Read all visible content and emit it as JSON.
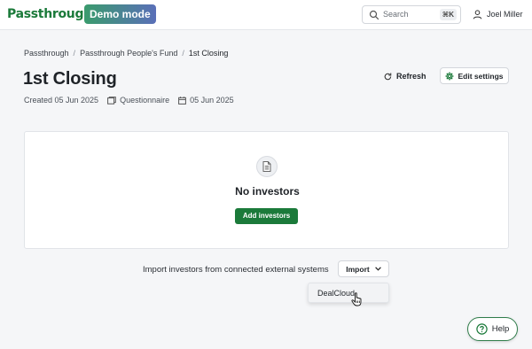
{
  "header": {
    "logo_text": "Passthrough",
    "demo_badge": "Demo mode",
    "search_placeholder": "Search",
    "search_shortcut": "⌘K",
    "user_name": "Joel Miller"
  },
  "breadcrumb": [
    "Passthrough",
    "Passthrough People's Fund",
    "1st Closing"
  ],
  "page": {
    "title": "1st Closing",
    "meta": {
      "created": "Created 05 Jun 2025",
      "type": "Questionnaire",
      "date": "05 Jun 2025"
    },
    "refresh_label": "Refresh",
    "edit_settings_label": "Edit settings"
  },
  "empty_state": {
    "title": "No investors",
    "button_label": "Add investors"
  },
  "import": {
    "label": "Import investors from connected external systems",
    "button_label": "Import",
    "options": [
      "DealCloud"
    ]
  },
  "help_label": "Help",
  "colors": {
    "brand_green": "#1b7a3a",
    "background": "#f5f6f8"
  }
}
